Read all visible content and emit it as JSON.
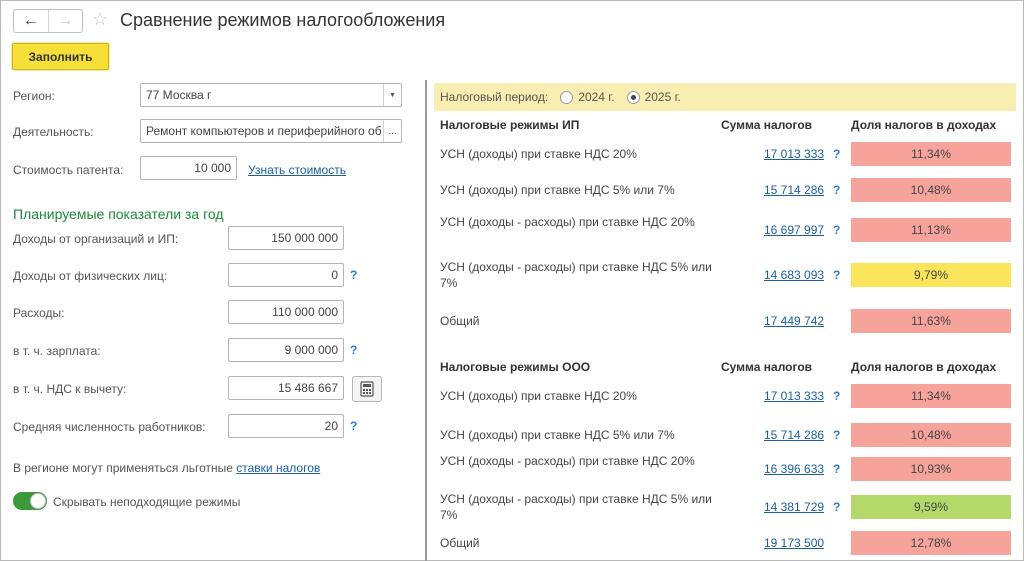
{
  "header": {
    "back_icon": "arrow-left-icon",
    "forward_icon": "arrow-right-icon",
    "favorite_icon": "star-icon",
    "title": "Сравнение режимов налогообложения",
    "fill_button": "Заполнить"
  },
  "left": {
    "region_label": "Регион:",
    "region_value": "77 Москва г",
    "activity_label": "Деятельность:",
    "activity_value": "Ремонт компьютеров и периферийного об",
    "patent_label": "Стоимость патента:",
    "patent_value": "10 000",
    "patent_link": "Узнать стоимость",
    "section_title": "Планируемые показатели за год",
    "income_orgs_label": "Доходы от организаций и ИП:",
    "income_orgs_value": "150 000 000",
    "income_persons_label": "Доходы от физических лиц:",
    "income_persons_value": "0",
    "expenses_label": "Расходы:",
    "expenses_value": "110 000 000",
    "salary_label": "в т. ч. зарплата:",
    "salary_value": "9 000 000",
    "vat_label": "в т. ч. НДС к вычету:",
    "vat_value": "15 486 667",
    "employees_label": "Средняя численность работников:",
    "employees_value": "20",
    "help_mark": "?",
    "benefits_text": "В регионе могут применяться льготные",
    "benefits_link": "ставки налогов",
    "hide_toggle_label": "Скрывать неподходящие режимы",
    "hide_toggle_on": true
  },
  "right": {
    "period_label": "Налоговый период:",
    "period_options": [
      "2024 г.",
      "2025 г."
    ],
    "period_selected": "2025 г.",
    "ip": {
      "header_mode": "Налоговые режимы ИП",
      "header_sum": "Сумма налогов",
      "header_share": "Доля налогов в доходах",
      "rows": [
        {
          "mode": "УСН (доходы) при ставке НДС 20%",
          "sum": "17 013 333",
          "share": "11,34%",
          "color": "#f6a39b",
          "help": true
        },
        {
          "mode": "УСН (доходы) при ставке НДС 5% или 7%",
          "sum": "15 714 286",
          "share": "10,48%",
          "color": "#f6a39b",
          "help": true
        },
        {
          "mode": "УСН (доходы - расходы) при ставке НДС 20%",
          "sum": "16 697 997",
          "share": "11,13%",
          "color": "#f6a39b",
          "help": true
        },
        {
          "mode": "УСН (доходы - расходы) при ставке НДС 5% или 7%",
          "sum": "14 683 093",
          "share": "9,79%",
          "color": "#f9e45c",
          "help": true
        },
        {
          "mode": "Общий",
          "sum": "17 449 742",
          "share": "11,63%",
          "color": "#f6a39b",
          "help": false
        }
      ]
    },
    "ooo": {
      "header_mode": "Налоговые режимы ООО",
      "header_sum": "Сумма налогов",
      "header_share": "Доля налогов в доходах",
      "rows": [
        {
          "mode": "УСН (доходы) при ставке НДС 20%",
          "sum": "17 013 333",
          "share": "11,34%",
          "color": "#f6a39b",
          "help": true
        },
        {
          "mode": "УСН (доходы) при ставке НДС 5% или 7%",
          "sum": "15 714 286",
          "share": "10,48%",
          "color": "#f6a39b",
          "help": true
        },
        {
          "mode": "УСН (доходы - расходы) при ставке НДС 20%",
          "sum": "16 396 633",
          "share": "10,93%",
          "color": "#f6a39b",
          "help": true
        },
        {
          "mode": "УСН (доходы - расходы) при ставке НДС 5% или 7%",
          "sum": "14 381 729",
          "share": "9,59%",
          "color": "#b4d96a",
          "help": true
        },
        {
          "mode": "Общий",
          "sum": "19 173 500",
          "share": "12,78%",
          "color": "#f6a39b",
          "help": false
        }
      ]
    }
  }
}
